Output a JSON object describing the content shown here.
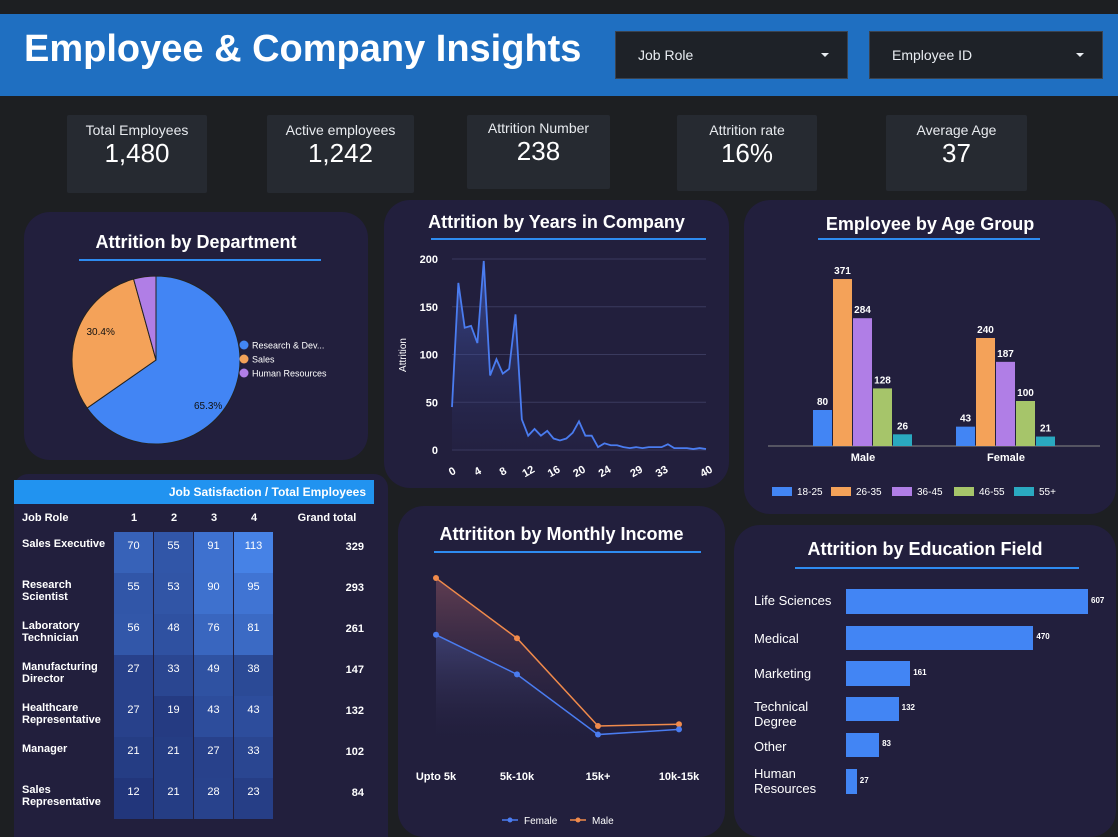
{
  "header": {
    "title": "Employee & Company Insights",
    "filters": [
      {
        "label": "Job Role"
      },
      {
        "label": "Employee ID"
      }
    ]
  },
  "kpis": [
    {
      "label": "Total Employees",
      "value": "1,480"
    },
    {
      "label": "Active employees",
      "value": "1,242"
    },
    {
      "label": "Attrition Number",
      "value": "238"
    },
    {
      "label": "Attrition rate",
      "value": "16%"
    },
    {
      "label": "Average Age",
      "value": "37"
    }
  ],
  "colors": {
    "accent": "#2e8bf0",
    "blue": "#4285f4",
    "orange": "#f4a259",
    "purple": "#b07ee6",
    "green": "#a6c56a",
    "teal": "#2aa9c0",
    "header_bg": "#1f6fc1",
    "card_bg": "#221f3d"
  },
  "dept_chart": {
    "title": "Attrition by Department"
  },
  "years_chart": {
    "title": "Attrition by Years in Company"
  },
  "age_chart": {
    "title": "Employee by Age Group"
  },
  "income_chart": {
    "title": "Attrititon by Monthly Income"
  },
  "edu_chart": {
    "title": "Attrition by Education Field"
  },
  "table": {
    "title": "Job Satisfaction / Total Employees",
    "columns": [
      "Job Role",
      "1",
      "2",
      "3",
      "4",
      "Grand total"
    ],
    "rows": [
      {
        "role": "Sales Executive",
        "v": [
          70,
          55,
          91,
          113
        ],
        "total": "329"
      },
      {
        "role": "Research Scientist",
        "v": [
          55,
          53,
          90,
          95
        ],
        "total": "293"
      },
      {
        "role": "Laboratory Technician",
        "v": [
          56,
          48,
          76,
          81
        ],
        "total": "261"
      },
      {
        "role": "Manufacturing Director",
        "v": [
          27,
          33,
          49,
          38
        ],
        "total": "147"
      },
      {
        "role": "Healthcare Representative",
        "v": [
          27,
          19,
          43,
          43
        ],
        "total": "132"
      },
      {
        "role": "Manager",
        "v": [
          21,
          21,
          27,
          33
        ],
        "total": "102"
      },
      {
        "role": "Sales Representative",
        "v": [
          12,
          21,
          28,
          23
        ],
        "total": "84"
      }
    ]
  },
  "chart_data": [
    {
      "type": "pie",
      "title": "Attrition by Department",
      "labels": [
        "Research & Dev...",
        "Sales",
        "Human Resources"
      ],
      "values": [
        65.3,
        30.4,
        4.3
      ],
      "data_labels": [
        "65.3%",
        "30.4%",
        ""
      ],
      "colors": [
        "#4285f4",
        "#f4a259",
        "#b07ee6"
      ],
      "legend": "right"
    },
    {
      "type": "area",
      "title": "Attrition by Years in Company",
      "ylabel": "Attrition",
      "xlabel": "",
      "ylim": [
        0,
        200
      ],
      "yticks": [
        0,
        50,
        100,
        150,
        200
      ],
      "xticks": [
        "0",
        "4",
        "8",
        "12",
        "16",
        "20",
        "24",
        "29",
        "33",
        "40"
      ],
      "x": [
        0,
        1,
        2,
        3,
        4,
        5,
        6,
        7,
        8,
        9,
        10,
        11,
        12,
        13,
        14,
        15,
        16,
        17,
        18,
        19,
        20,
        21,
        22,
        23,
        24,
        25,
        26,
        27,
        28,
        29,
        30,
        31,
        32,
        33,
        34,
        35,
        36,
        37,
        38,
        39,
        40
      ],
      "values": [
        45,
        175,
        128,
        130,
        112,
        198,
        78,
        95,
        80,
        85,
        142,
        32,
        15,
        22,
        15,
        20,
        12,
        10,
        12,
        18,
        30,
        15,
        15,
        3,
        7,
        5,
        5,
        3,
        2,
        3,
        2,
        3,
        3,
        3,
        6,
        2,
        2,
        2,
        1,
        2,
        1
      ],
      "grid": true
    },
    {
      "type": "bar",
      "title": "Employee by Age Group",
      "categories": [
        "Male",
        "Female"
      ],
      "series": [
        {
          "name": "18-25",
          "values": [
            80,
            43
          ]
        },
        {
          "name": "26-35",
          "values": [
            371,
            240
          ]
        },
        {
          "name": "36-45",
          "values": [
            284,
            187
          ]
        },
        {
          "name": "46-55",
          "values": [
            128,
            100
          ]
        },
        {
          "name": "55+",
          "values": [
            26,
            21
          ]
        }
      ],
      "ylim": [
        0,
        400
      ],
      "legend": "bottom"
    },
    {
      "type": "line",
      "title": "Attrititon by Monthly Income",
      "categories": [
        "Upto 5k",
        "5k-10k",
        "15k+",
        "10k-15k"
      ],
      "series": [
        {
          "name": "Female",
          "values": [
            0.6,
            0.37,
            0.02,
            0.05
          ]
        },
        {
          "name": "Male",
          "values": [
            0.93,
            0.58,
            0.07,
            0.08
          ]
        }
      ],
      "legend": "bottom"
    },
    {
      "type": "bar",
      "orientation": "horizontal",
      "title": "Attrition by Education Field",
      "categories": [
        "Life Sciences",
        "Medical",
        "Marketing",
        "Technical Degree",
        "Other",
        "Human Resources"
      ],
      "values": [
        607,
        470,
        161,
        132,
        83,
        27
      ],
      "xlim": [
        0,
        607
      ]
    }
  ]
}
